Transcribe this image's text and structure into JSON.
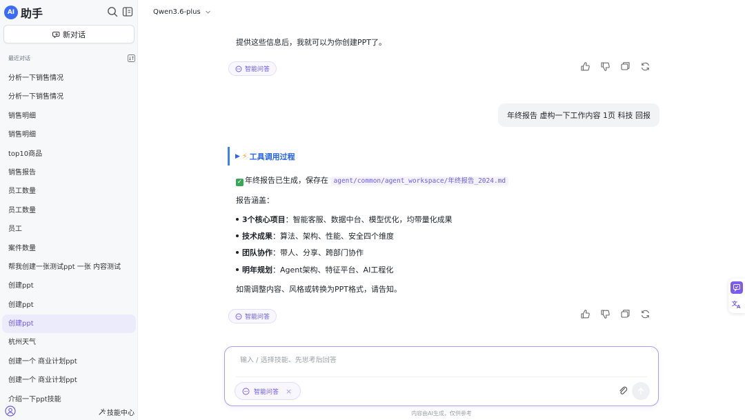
{
  "brand": {
    "logo_text": "AI",
    "title": "助手"
  },
  "sidebar": {
    "new_chat_label": "新对话",
    "recent_label": "最近对话",
    "items": [
      {
        "label": "分析一下销售情况"
      },
      {
        "label": "分析一下销售情况"
      },
      {
        "label": "销售明细"
      },
      {
        "label": "销售明细"
      },
      {
        "label": "top10商品"
      },
      {
        "label": "销售报告"
      },
      {
        "label": "员工数量"
      },
      {
        "label": "员工数量"
      },
      {
        "label": "员工"
      },
      {
        "label": "案件数量"
      },
      {
        "label": "帮我创建一张测试ppt 一张 内容测试"
      },
      {
        "label": "创建ppt"
      },
      {
        "label": "创建ppt"
      },
      {
        "label": "创建ppt",
        "active": true
      },
      {
        "label": "杭州天气"
      },
      {
        "label": "创建一个 商业计划ppt"
      },
      {
        "label": "创建一个 商业计划ppt"
      },
      {
        "label": "介绍一下ppt技能"
      }
    ],
    "skill_center_label": "技能中心"
  },
  "header": {
    "model": "Qwen3.6-plus"
  },
  "chat": {
    "msg1_text": "提供这些信息后，我就可以为你创建PPT了。",
    "tag_label": "智能问答",
    "user_message": "年终报告 虚构一下工作内容 1页 科技 回报",
    "tool_title": "工具调用过程",
    "result_prefix": "年终报告已生成，保存在",
    "result_path": "agent/common/agent_workspace/年终报告_2024.md",
    "covers_label": "报告涵盖：",
    "bullets": [
      {
        "title": "3个核心项目",
        "text": "：智能客服、数据中台、模型优化，均带量化成果"
      },
      {
        "title": "技术成果",
        "text": "：算法、架构、性能、安全四个维度"
      },
      {
        "title": "团队协作",
        "text": "：带人、分享、跨部门协作"
      },
      {
        "title": "明年规划",
        "text": "：Agent架构、特征平台、AI工程化"
      }
    ],
    "closing": "如需调整内容、风格或转换为PPT格式，请告知。"
  },
  "input": {
    "placeholder": "输入 / 选择技能、先思考后回答",
    "value": "",
    "tag_label": "智能问答"
  },
  "disclaimer": "内容由AI生成，仅供参考",
  "colors": {
    "accent": "#6e5ce6",
    "tool_blue": "#2563eb",
    "sidebar_bg": "#f7f8fa"
  }
}
